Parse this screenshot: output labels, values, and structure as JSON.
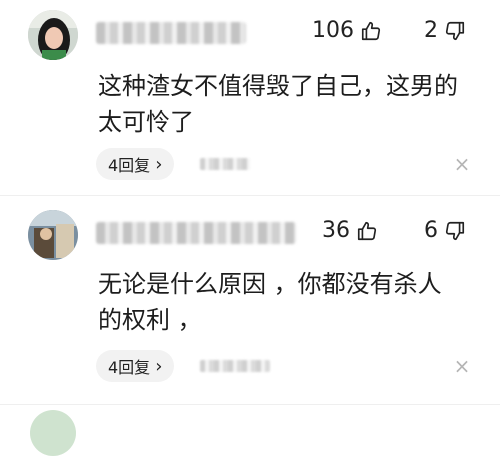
{
  "comments": [
    {
      "likes": "106",
      "dislikes": "2",
      "text_line1": "这种渣女不值得毁了自己，这男的",
      "text_line2": "太可怜了",
      "reply_label": "4回复",
      "reply_chevron": "›",
      "close_glyph": "×"
    },
    {
      "likes": "36",
      "dislikes": "6",
      "text_line1": "无论是什么原因 ，你都没有杀人",
      "text_line2": "的权利 ，",
      "reply_label": "4回复",
      "reply_chevron": "›",
      "close_glyph": "×"
    }
  ],
  "icons": {
    "like": "thumbs-up-icon",
    "dislike": "thumbs-down-icon",
    "close": "close-icon"
  },
  "colors": {
    "text": "#1d1d1d",
    "pill_bg": "#f2f2f2",
    "muted": "#b5b5b5"
  }
}
